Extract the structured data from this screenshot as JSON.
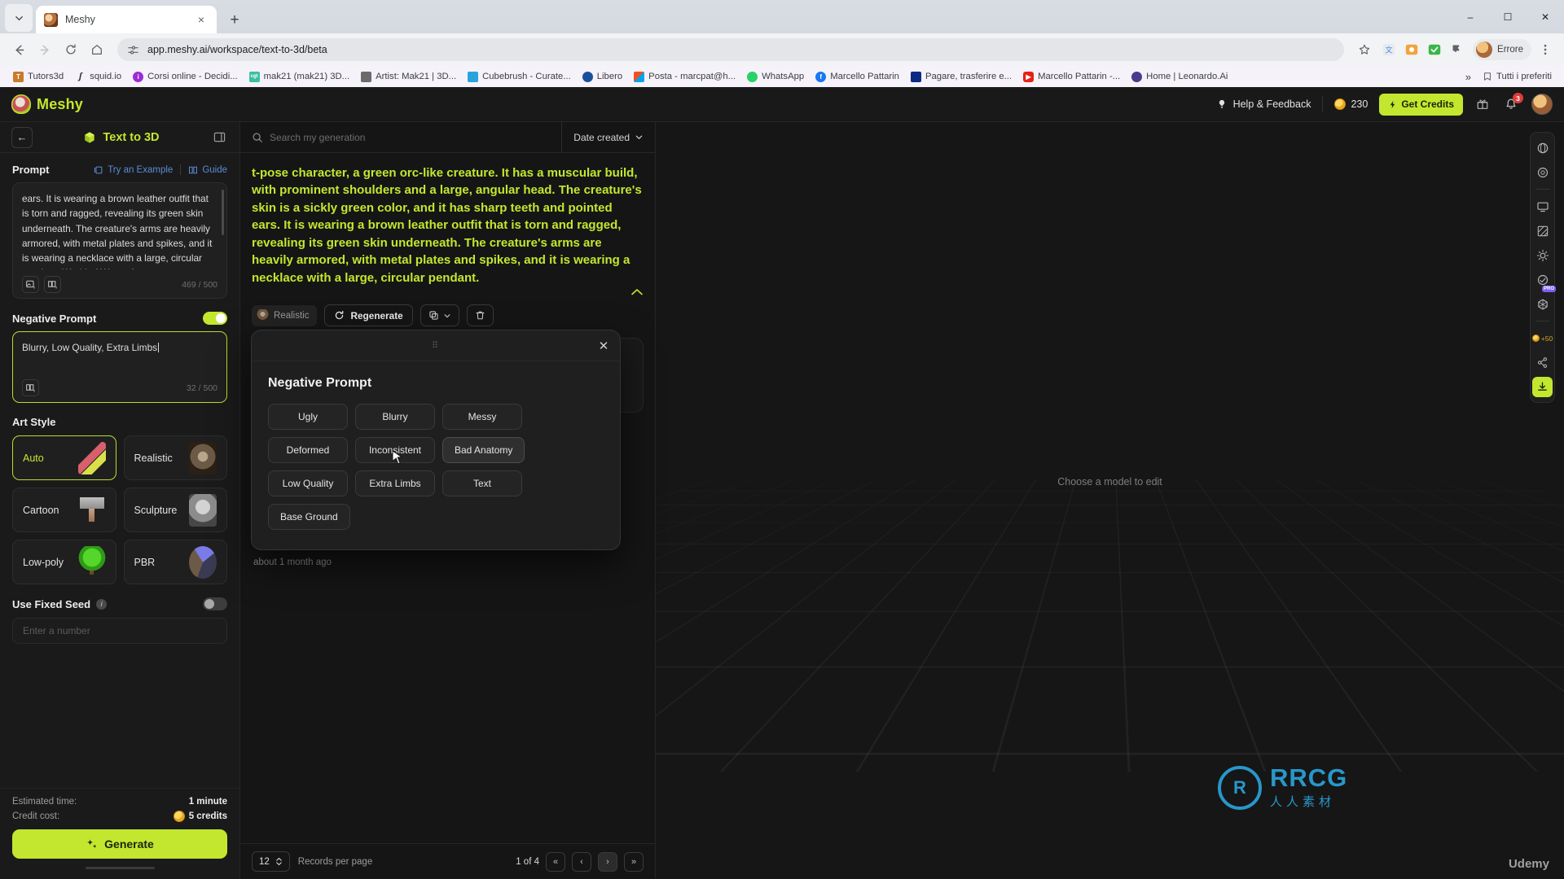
{
  "browser": {
    "tab": {
      "title": "Meshy",
      "favicon": "meshy-favicon",
      "close_label": "×"
    },
    "new_tab_label": "+",
    "window_controls": {
      "minimize": "–",
      "maximize": "☐",
      "close": "✕"
    },
    "nav": {
      "back": "←",
      "forward": "→",
      "reload": "↻",
      "home": "⌂"
    },
    "url": "app.meshy.ai/workspace/text-to-3d/beta",
    "profile_name": "Errore",
    "bookmarks": [
      {
        "label": "Tutors3d",
        "color": "#c97b2a"
      },
      {
        "label": "squid.io",
        "color": "#2b2b2b"
      },
      {
        "label": "Corsi online - Decidi...",
        "color": "#9c2bd6"
      },
      {
        "label": "mak21 (mak21) 3D...",
        "color": "#3bbfa0"
      },
      {
        "label": "Artist: Mak21 | 3D...",
        "color": "#6b6b6b"
      },
      {
        "label": "Cubebrush - Curate...",
        "color": "#2aa3dc"
      },
      {
        "label": "Libero",
        "color": "#1a4f9c"
      },
      {
        "label": "Posta - marcpat@h...",
        "color": "#e8a317"
      },
      {
        "label": "WhatsApp",
        "color": "#25d366"
      },
      {
        "label": "Marcello Pattarin",
        "color": "#1877f2"
      },
      {
        "label": "Pagare, trasferire e...",
        "color": "#0b2a82"
      },
      {
        "label": "Marcello Pattarin -...",
        "color": "#e62117"
      },
      {
        "label": "Home | Leonardo.Ai",
        "color": "#4a3b8c"
      }
    ],
    "bookmarks_overflow": "»",
    "all_bookmarks_label": "Tutti i preferiti"
  },
  "header": {
    "logo_text": "Meshy",
    "help_label": "Help & Feedback",
    "credits_amount": "230",
    "get_credits_label": "Get Credits",
    "notification_count": "3"
  },
  "sidebar": {
    "title": "Text to 3D",
    "back_label": "←",
    "prompt": {
      "label": "Prompt",
      "try_example_label": "Try an Example",
      "guide_label": "Guide",
      "value": "ears. It is wearing a brown leather outfit that is torn and ragged, revealing its green skin underneath. The creature's arms are heavily armored, with metal plates and spikes, and it is wearing a necklace with a large, circular pendant, World of Warcraft",
      "counter": "469 / 500"
    },
    "negative_prompt": {
      "label": "Negative Prompt",
      "value": "Blurry, Low Quality, Extra Limbs",
      "counter": "32 / 500",
      "enabled": true
    },
    "art_style": {
      "label": "Art Style",
      "selected": "Auto",
      "options": [
        {
          "name": "Auto",
          "thumb": "magic-wand-thumb"
        },
        {
          "name": "Realistic",
          "thumb": "realistic-head-thumb"
        },
        {
          "name": "Cartoon",
          "thumb": "cartoon-hammer-thumb"
        },
        {
          "name": "Sculpture",
          "thumb": "sculpture-bust-thumb"
        },
        {
          "name": "Low-poly",
          "thumb": "lowpoly-tree-thumb"
        },
        {
          "name": "PBR",
          "thumb": "pbr-sphere-thumb"
        }
      ]
    },
    "fixed_seed": {
      "label": "Use Fixed Seed",
      "enabled": false,
      "placeholder": "Enter a number"
    },
    "footer": {
      "estimated_time_label": "Estimated time:",
      "estimated_time_value": "1 minute",
      "credit_cost_label": "Credit cost:",
      "credit_cost_value": "5 credits",
      "generate_label": "Generate"
    }
  },
  "center": {
    "search_placeholder": "Search my generation",
    "sort_label": "Date created",
    "generation": {
      "prompt": "t-pose character, a green orc-like creature. It has a muscular build, with prominent shoulders and a large, angular head. The creature's skin is a sickly green color, and it has sharp teeth and pointed ears. It is wearing a brown leather outfit that is torn and ragged, revealing its green skin underneath. The creature's arms are heavily armored, with metal plates and spikes, and it is wearing a necklace with a large, circular pendant.",
      "style_chip": "Realistic",
      "regenerate_label": "Regenerate",
      "timestamp": "about 1 month ago"
    },
    "pager": {
      "per_page_value": "12",
      "per_page_label": "Records per page",
      "page_info": "1 of 4",
      "first_label": "«",
      "prev_label": "‹",
      "next_label": "›",
      "last_label": "»"
    }
  },
  "modal": {
    "title": "Negative Prompt",
    "close_label": "✕",
    "tags": [
      "Ugly",
      "Blurry",
      "Messy",
      "Deformed",
      "Inconsistent",
      "Bad Anatomy",
      "Low Quality",
      "Extra Limbs",
      "Text",
      "Base Ground"
    ],
    "hovered_tag": "Bad Anatomy"
  },
  "viewport": {
    "hint": "Choose a model to edit",
    "tools": [
      {
        "name": "sphere-tool"
      },
      {
        "name": "circle-tool"
      },
      {
        "name": "divider-1"
      },
      {
        "name": "display-tool"
      },
      {
        "name": "texture-tool"
      },
      {
        "name": "lighting-tool"
      },
      {
        "name": "pro-tool",
        "badge": "PRO"
      },
      {
        "name": "geometry-tool"
      },
      {
        "name": "divider-2"
      },
      {
        "name": "credits-tool",
        "badge": "+50"
      },
      {
        "name": "share-tool"
      },
      {
        "name": "download-tool"
      }
    ],
    "pro_badge": "PRO",
    "credits_badge": "+50"
  },
  "watermark": {
    "mark": "R",
    "big": "RRCG",
    "sub": "人人素材",
    "brand": "Udemy"
  }
}
